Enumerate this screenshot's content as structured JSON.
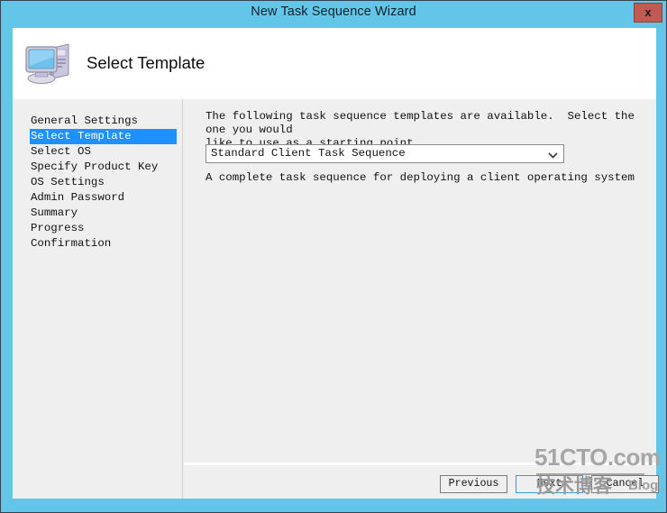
{
  "window": {
    "title": "New Task Sequence Wizard",
    "close_label": "x",
    "accent_color": "#63c6e8",
    "close_button_color": "#c15b52"
  },
  "header": {
    "title": "Select Template",
    "icon": "computer-icon"
  },
  "sidebar": {
    "selected_index": 1,
    "highlight_color": "#1e90ff",
    "items": [
      {
        "label": "General Settings"
      },
      {
        "label": "Select Template"
      },
      {
        "label": "Select OS"
      },
      {
        "label": "Specify Product Key"
      },
      {
        "label": "OS Settings"
      },
      {
        "label": "Admin Password"
      },
      {
        "label": "Summary"
      },
      {
        "label": "Progress"
      },
      {
        "label": "Confirmation"
      }
    ]
  },
  "main": {
    "intro_text": "The following task sequence templates are available.  Select the one you would\nlike to use as a starting point.",
    "template_select": {
      "value": "Standard Client Task Sequence",
      "icon": "chevron-down-icon",
      "options": [
        "Standard Client Task Sequence"
      ]
    },
    "description_text": "A complete task sequence for deploying a client operating system"
  },
  "footer": {
    "buttons": [
      {
        "label": "Previous",
        "name": "previous-button"
      },
      {
        "label": "Next",
        "name": "next-button"
      },
      {
        "label": "Cancel",
        "name": "cancel-button"
      }
    ]
  },
  "watermark": {
    "main": "51CTO.com",
    "chinese": "技术博客",
    "suffix": "Blog"
  }
}
